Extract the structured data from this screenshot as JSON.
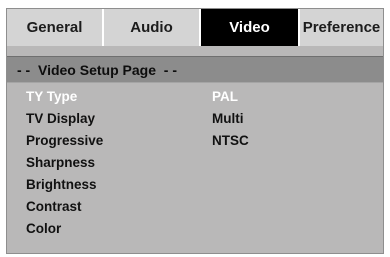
{
  "tabs": [
    {
      "label": "General"
    },
    {
      "label": "Audio"
    },
    {
      "label": "Video"
    },
    {
      "label": "Preference"
    }
  ],
  "active_tab": "Video",
  "page_title": "- -  Video Setup Page  - -",
  "menu": [
    {
      "label": "TY Type"
    },
    {
      "label": "TV Display"
    },
    {
      "label": "Progressive"
    },
    {
      "label": "Sharpness"
    },
    {
      "label": "Brightness"
    },
    {
      "label": "Contrast"
    },
    {
      "label": "Color"
    }
  ],
  "selected_menu_item": "TY Type",
  "options": [
    {
      "label": "PAL"
    },
    {
      "label": "Multi"
    },
    {
      "label": "NTSC"
    }
  ],
  "selected_option": "PAL",
  "colors": {
    "panel_bg": "#b9b8b8",
    "tab_bg": "#d4d4d4",
    "active_tab_bg": "#000000",
    "title_bar_bg": "#8c8c8c",
    "highlight_text": "#ffffff"
  }
}
